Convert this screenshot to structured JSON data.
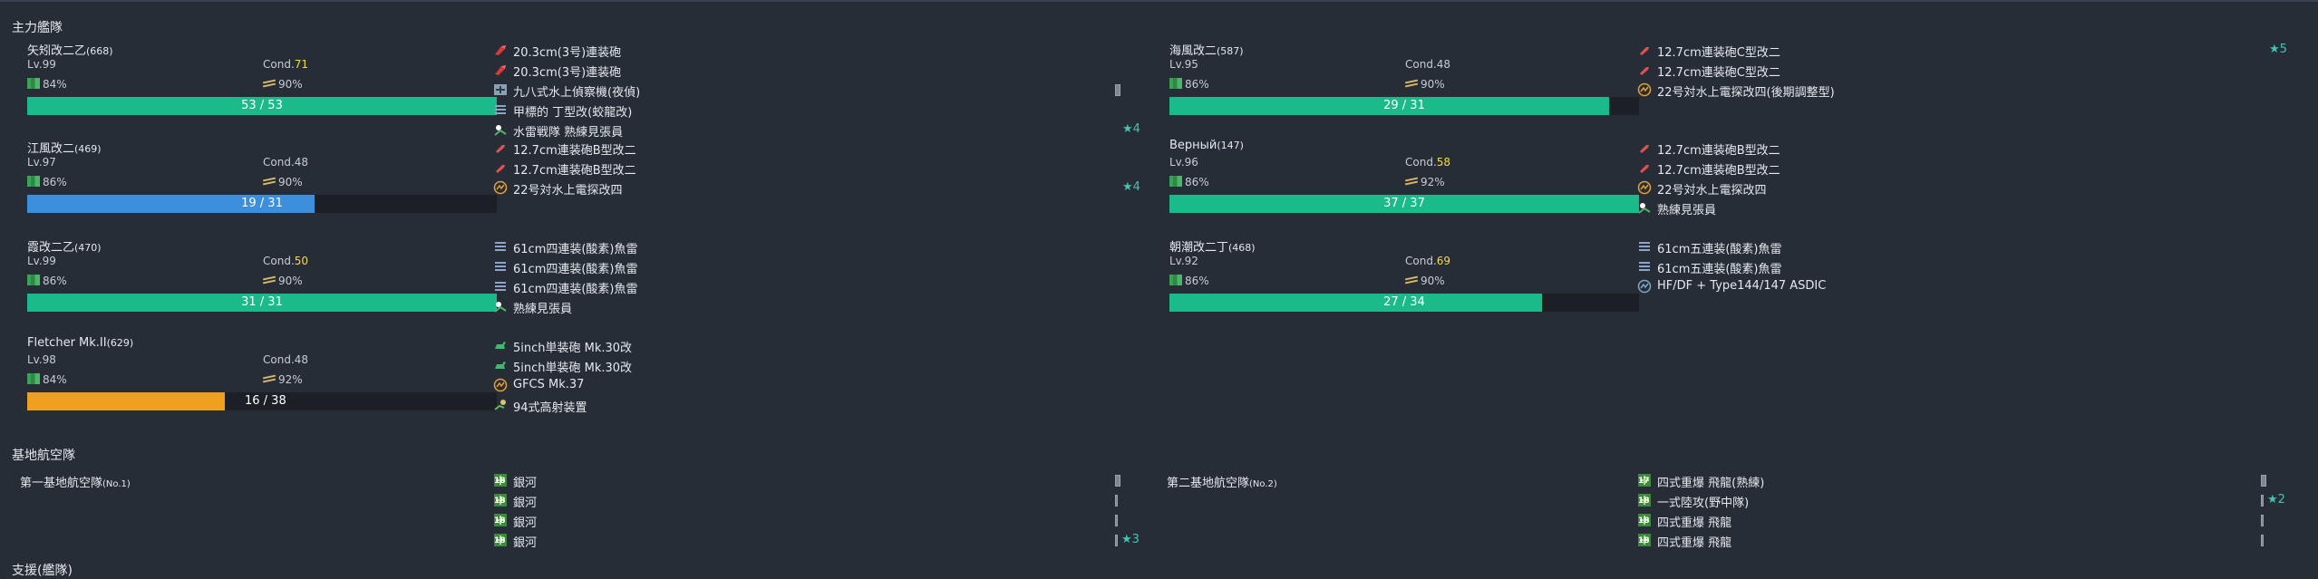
{
  "sections": {
    "main_fleet": "主力艦隊",
    "base_air": "基地航空隊",
    "cut_off": "支援(艦隊)"
  },
  "fleet": [
    {
      "name": "矢矧改二乙",
      "id": "(668)",
      "lv": "Lv.99",
      "cond_label": "Cond.",
      "cond": "71",
      "cond_hi": true,
      "fuel": "84%",
      "ammo": "90%",
      "hp": "53 / 53",
      "hp_frac": 1.0,
      "hp_color": "#1aba8a",
      "equips": [
        {
          "name": "20.3cm(3号)連装砲",
          "icon": "main-gun-red-icon",
          "gauge": false,
          "star": ""
        },
        {
          "name": "20.3cm(3号)連装砲",
          "icon": "main-gun-red-icon",
          "gauge": false,
          "star": ""
        },
        {
          "name": "九八式水上偵察機(夜偵)",
          "icon": "seaplane-icon",
          "gauge": true,
          "star": ""
        },
        {
          "name": "甲標的 丁型改(蛟龍改)",
          "icon": "torpedo-icon",
          "gauge": false,
          "star": ""
        },
        {
          "name": "水雷戦隊 熟練見張員",
          "icon": "lookout-icon",
          "gauge": false,
          "star": "★4"
        }
      ]
    },
    {
      "name": "海風改二",
      "id": "(587)",
      "lv": "Lv.95",
      "cond_label": "Cond.",
      "cond": "48",
      "cond_hi": false,
      "fuel": "86%",
      "ammo": "90%",
      "hp": "29 / 31",
      "hp_frac": 0.9355,
      "hp_color": "#1aba8a",
      "equips": [
        {
          "name": "12.7cm連装砲C型改二",
          "icon": "small-gun-icon",
          "gauge": false,
          "star": "★5"
        },
        {
          "name": "12.7cm連装砲C型改二",
          "icon": "small-gun-icon",
          "gauge": false,
          "star": ""
        },
        {
          "name": "22号対水上電探改四(後期調整型)",
          "icon": "radar-icon",
          "gauge": false,
          "star": ""
        }
      ]
    },
    {
      "name": "江風改二",
      "id": "(469)",
      "lv": "Lv.97",
      "cond_label": "Cond.",
      "cond": "48",
      "cond_hi": false,
      "fuel": "86%",
      "ammo": "90%",
      "hp": "19 / 31",
      "hp_frac": 0.6129,
      "hp_color": "#3c8fdc",
      "equips": [
        {
          "name": "12.7cm連装砲B型改二",
          "icon": "small-gun-icon",
          "gauge": false,
          "star": ""
        },
        {
          "name": "12.7cm連装砲B型改二",
          "icon": "small-gun-icon",
          "gauge": false,
          "star": ""
        },
        {
          "name": "22号対水上電探改四",
          "icon": "radar-icon",
          "gauge": false,
          "star": "★4"
        }
      ]
    },
    {
      "name": "Верный",
      "id": "(147)",
      "lv": "Lv.96",
      "cond_label": "Cond.",
      "cond": "58",
      "cond_hi": true,
      "fuel": "86%",
      "ammo": "92%",
      "hp": "37 / 37",
      "hp_frac": 1.0,
      "hp_color": "#1aba8a",
      "equips": [
        {
          "name": "12.7cm連装砲B型改二",
          "icon": "small-gun-icon",
          "gauge": false,
          "star": ""
        },
        {
          "name": "12.7cm連装砲B型改二",
          "icon": "small-gun-icon",
          "gauge": false,
          "star": ""
        },
        {
          "name": "22号対水上電探改四",
          "icon": "radar-icon",
          "gauge": false,
          "star": ""
        },
        {
          "name": "熟練見張員",
          "icon": "lookout-icon",
          "gauge": false,
          "star": ""
        }
      ]
    },
    {
      "name": "霞改二乙",
      "id": "(470)",
      "lv": "Lv.99",
      "cond_label": "Cond.",
      "cond": "50",
      "cond_hi": true,
      "fuel": "86%",
      "ammo": "90%",
      "hp": "31 / 31",
      "hp_frac": 1.0,
      "hp_color": "#1aba8a",
      "equips": [
        {
          "name": "61cm四連装(酸素)魚雷",
          "icon": "torpedo-icon",
          "gauge": false,
          "star": ""
        },
        {
          "name": "61cm四連装(酸素)魚雷",
          "icon": "torpedo-icon",
          "gauge": false,
          "star": ""
        },
        {
          "name": "61cm四連装(酸素)魚雷",
          "icon": "torpedo-icon",
          "gauge": false,
          "star": ""
        },
        {
          "name": "熟練見張員",
          "icon": "lookout-icon",
          "gauge": false,
          "star": ""
        }
      ]
    },
    {
      "name": "朝潮改二丁",
      "id": "(468)",
      "lv": "Lv.92",
      "cond_label": "Cond.",
      "cond": "69",
      "cond_hi": true,
      "fuel": "86%",
      "ammo": "90%",
      "hp": "27 / 34",
      "hp_frac": 0.794,
      "hp_color": "#1aba8a",
      "equips": [
        {
          "name": "61cm五連装(酸素)魚雷",
          "icon": "torpedo-icon",
          "gauge": false,
          "star": ""
        },
        {
          "name": "61cm五連装(酸素)魚雷",
          "icon": "torpedo-icon",
          "gauge": false,
          "star": ""
        },
        {
          "name": "HF/DF + Type144/147 ASDIC",
          "icon": "sonar-icon",
          "gauge": false,
          "star": ""
        }
      ]
    },
    {
      "name": "Fletcher Mk.II",
      "id": "(629)",
      "lv": "Lv.98",
      "cond_label": "Cond.",
      "cond": "48",
      "cond_hi": false,
      "fuel": "84%",
      "ammo": "92%",
      "hp": "16 / 38",
      "hp_frac": 0.421,
      "hp_color": "#f0a01e",
      "equips": [
        {
          "name": "5inch単装砲 Mk.30改",
          "icon": "small-gun-green-icon",
          "gauge": false,
          "star": ""
        },
        {
          "name": "5inch単装砲 Mk.30改",
          "icon": "small-gun-green-icon",
          "gauge": false,
          "star": ""
        },
        {
          "name": "GFCS Mk.37",
          "icon": "radar-icon",
          "gauge": false,
          "star": ""
        },
        {
          "name": "94式高射装置",
          "icon": "aa-director-icon",
          "gauge": false,
          "star": ""
        }
      ]
    }
  ],
  "bases": [
    {
      "name": "第一基地航空隊",
      "no": "(No.1)",
      "squadrons": [
        {
          "count": "18",
          "name": "銀河",
          "star": ""
        },
        {
          "count": "18",
          "name": "銀河",
          "star": ""
        },
        {
          "count": "18",
          "name": "銀河",
          "star": ""
        },
        {
          "count": "18",
          "name": "銀河",
          "star": "★3"
        }
      ]
    },
    {
      "name": "第二基地航空隊",
      "no": "(No.2)",
      "squadrons": [
        {
          "count": "17",
          "name": "四式重爆 飛龍(熟練)",
          "star": ""
        },
        {
          "count": "18",
          "name": "一式陸攻(野中隊)",
          "star": "★2"
        },
        {
          "count": "18",
          "name": "四式重爆 飛龍",
          "star": ""
        },
        {
          "count": "18",
          "name": "四式重爆 飛龍",
          "star": ""
        }
      ]
    }
  ],
  "colors": {
    "background": "#272d37",
    "hp_green": "#1aba8a",
    "hp_blue": "#3c8fdc",
    "hp_orange": "#f0a01e",
    "cond_highlight": "#f2d94e",
    "star": "#46c3b3"
  }
}
